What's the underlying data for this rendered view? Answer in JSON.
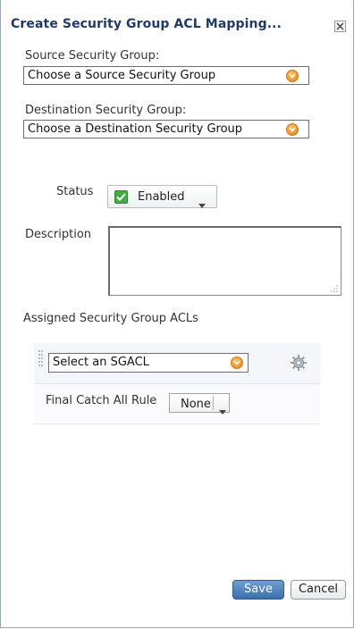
{
  "dialog": {
    "title": "Create Security Group ACL Mapping...",
    "close_icon": "close-icon"
  },
  "source": {
    "label": "Source Security Group:",
    "value": "Choose a Source Security Group"
  },
  "destination": {
    "label": "Destination Security Group:",
    "value": "Choose a Destination Security Group"
  },
  "status": {
    "label": "Status",
    "value": "Enabled",
    "checked": true,
    "accent": "#47a847"
  },
  "description": {
    "label": "Description",
    "value": ""
  },
  "acls": {
    "label": "Assigned Security Group ACLs",
    "select_value": "Select an SGACL",
    "gear_icon": "gear-icon",
    "catch_all_label": "Final Catch All Rule",
    "catch_all_value": "None"
  },
  "buttons": {
    "save": "Save",
    "cancel": "Cancel"
  },
  "colors": {
    "title": "#1f3b66",
    "primary_button": "#3c6fab",
    "dropdown_accent": "#e8952a"
  }
}
